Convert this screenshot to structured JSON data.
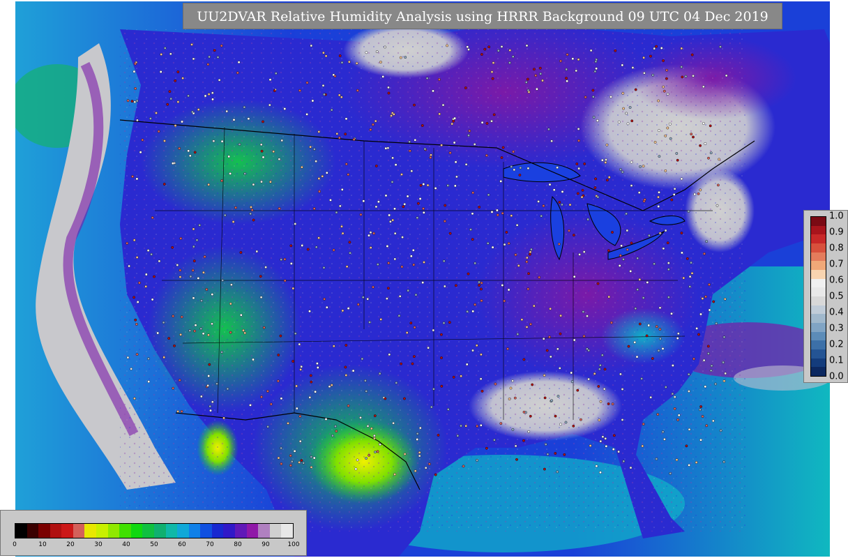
{
  "title": "UU2DVAR Relative Humidity Analysis using HRRR Background 09 UTC 04 Dec 2019",
  "map": {
    "region": "Contiguous United States and surroundings",
    "colors": {
      "ocean_dry": "#1f8fd6",
      "ocean_moist": "#1c3bd8",
      "land_moist": "#2a2ad0",
      "very_moist": "#7a1fa0",
      "saturated": "#c8c8c8",
      "mid": "#1ec07a",
      "dry": "#f0f000",
      "border": "#000000"
    }
  },
  "rh_colorbar": {
    "ticks": [
      "0",
      "10",
      "20",
      "30",
      "40",
      "50",
      "60",
      "70",
      "80",
      "90",
      "100"
    ],
    "colors": [
      "#000000",
      "#3a0000",
      "#7a0000",
      "#b01010",
      "#cc1818",
      "#d4605a",
      "#e8e800",
      "#c8f000",
      "#90e800",
      "#40e000",
      "#10d810",
      "#10c040",
      "#10b070",
      "#10b8a8",
      "#10a8d8",
      "#1080e8",
      "#1050e0",
      "#1828d0",
      "#3018c8",
      "#6018b8",
      "#9018a8",
      "#b080c0",
      "#d0d0d0",
      "#e8e8e8"
    ]
  },
  "increment_colorbar": {
    "ticks": [
      "1.0",
      "0.9",
      "0.8",
      "0.7",
      "0.6",
      "0.5",
      "0.4",
      "0.3",
      "0.2",
      "0.1",
      "0.0"
    ],
    "colors": [
      "#7a0a14",
      "#a8141c",
      "#c82828",
      "#d8503c",
      "#e47c5c",
      "#f0a878",
      "#f8d4b0",
      "#f0f0f0",
      "#e8e8e8",
      "#d8d8d8",
      "#c0ccd8",
      "#a0b8cc",
      "#80a4c4",
      "#5c8cb8",
      "#3c70a8",
      "#245494",
      "#143c7c",
      "#0c2860"
    ]
  }
}
